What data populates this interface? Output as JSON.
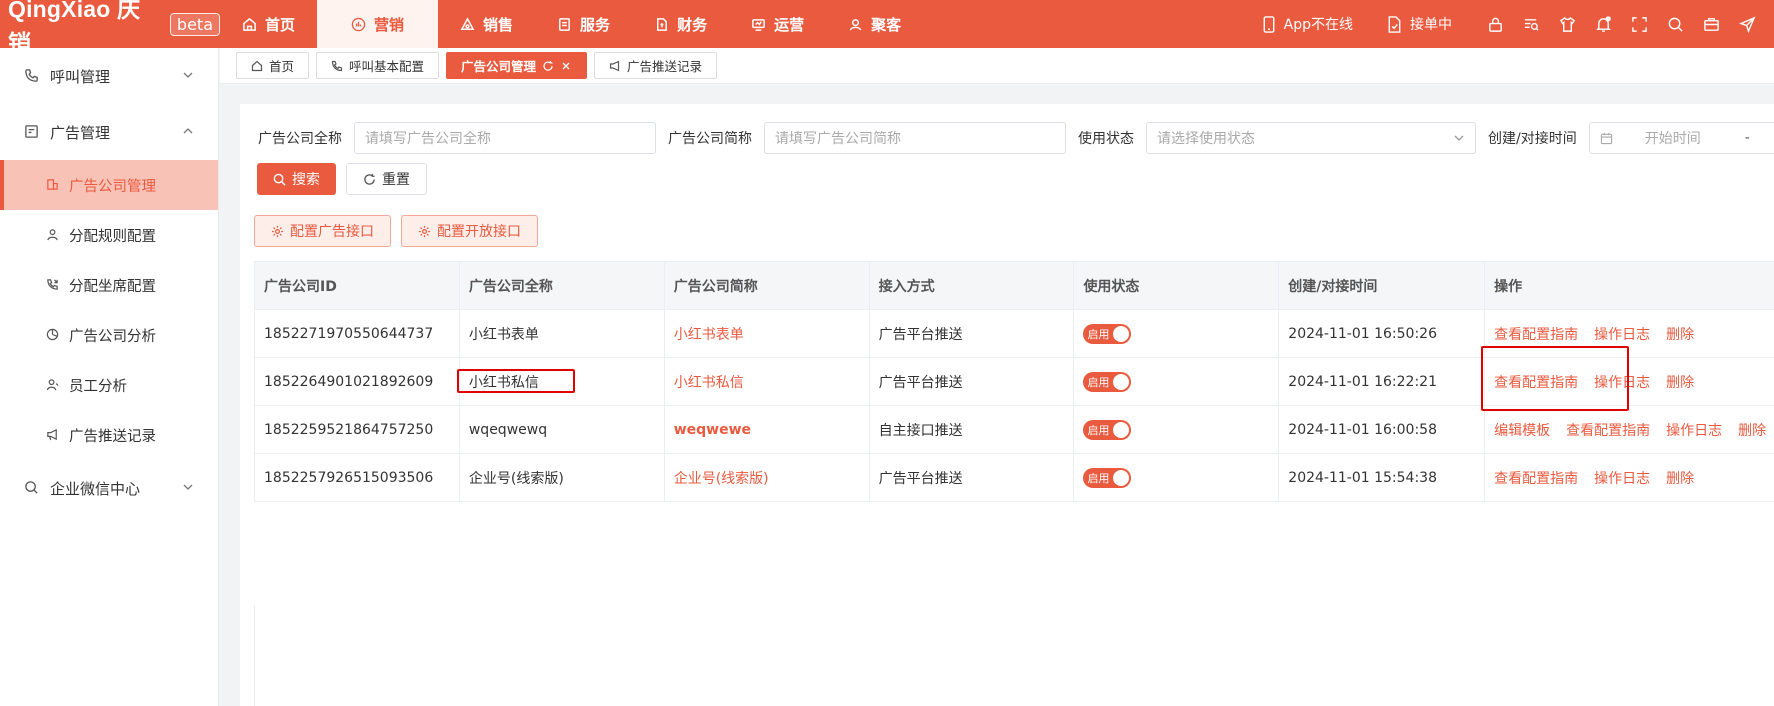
{
  "brand": {
    "logo": "QingXiao 庆销",
    "badge": "beta"
  },
  "nav": [
    {
      "label": "首页",
      "icon": "home-icon"
    },
    {
      "label": "营销",
      "icon": "chart-icon"
    },
    {
      "label": "销售",
      "icon": "sales-icon"
    },
    {
      "label": "服务",
      "icon": "service-icon"
    },
    {
      "label": "财务",
      "icon": "finance-icon"
    },
    {
      "label": "运营",
      "icon": "operation-icon"
    },
    {
      "label": "聚客",
      "icon": "customers-icon"
    }
  ],
  "top_right": {
    "app_status": "App不在线",
    "orders": "接单中"
  },
  "sidebar": {
    "groups": [
      {
        "label": "呼叫管理"
      },
      {
        "label": "广告管理"
      },
      {
        "label": "企业微信中心"
      }
    ],
    "items": [
      {
        "label": "广告公司管理"
      },
      {
        "label": "分配规则配置"
      },
      {
        "label": "分配坐席配置"
      },
      {
        "label": "广告公司分析"
      },
      {
        "label": "员工分析"
      },
      {
        "label": "广告推送记录"
      }
    ]
  },
  "tabs": [
    {
      "label": "首页"
    },
    {
      "label": "呼叫基本配置"
    },
    {
      "label": "广告公司管理"
    },
    {
      "label": "广告推送记录"
    }
  ],
  "filters": {
    "full_name_label": "广告公司全称",
    "full_name_placeholder": "请填写广告公司全称",
    "short_name_label": "广告公司简称",
    "short_name_placeholder": "请填写广告公司简称",
    "status_label": "使用状态",
    "status_placeholder": "请选择使用状态",
    "time_label": "创建/对接时间",
    "time_start_placeholder": "开始时间",
    "time_sep": "-"
  },
  "buttons": {
    "search": "搜索",
    "reset": "重置",
    "config_ad": "配置广告接口",
    "config_open": "配置开放接口"
  },
  "table": {
    "headers": [
      "广告公司ID",
      "广告公司全称",
      "广告公司简称",
      "接入方式",
      "使用状态",
      "创建/对接时间",
      "操作"
    ],
    "rows": [
      {
        "id": "1852271970550644737",
        "full": "小红书表单",
        "short": "小红书表单",
        "method": "广告平台推送",
        "status": "启用",
        "time": "2024-11-01 16:50:26",
        "actions": [
          "查看配置指南",
          "操作日志",
          "删除"
        ]
      },
      {
        "id": "1852264901021892609",
        "full": "小红书私信",
        "short": "小红书私信",
        "method": "广告平台推送",
        "status": "启用",
        "time": "2024-11-01 16:22:21",
        "actions": [
          "查看配置指南",
          "操作日志",
          "删除"
        ]
      },
      {
        "id": "1852259521864757250",
        "full": "wqeqwewq",
        "short": "weqwewe",
        "method": "自主接口推送",
        "status": "启用",
        "time": "2024-11-01 16:00:58",
        "actions": [
          "编辑模板",
          "查看配置指南",
          "操作日志",
          "删除"
        ]
      },
      {
        "id": "1852257926515093506",
        "full": "企业号(线索版)",
        "short": "企业号(线索版)",
        "method": "广告平台推送",
        "status": "启用",
        "time": "2024-11-01 15:54:38",
        "actions": [
          "查看配置指南",
          "操作日志",
          "删除"
        ]
      }
    ]
  },
  "colors": {
    "brand": "#ea5a3f",
    "highlight": "#e00000"
  }
}
